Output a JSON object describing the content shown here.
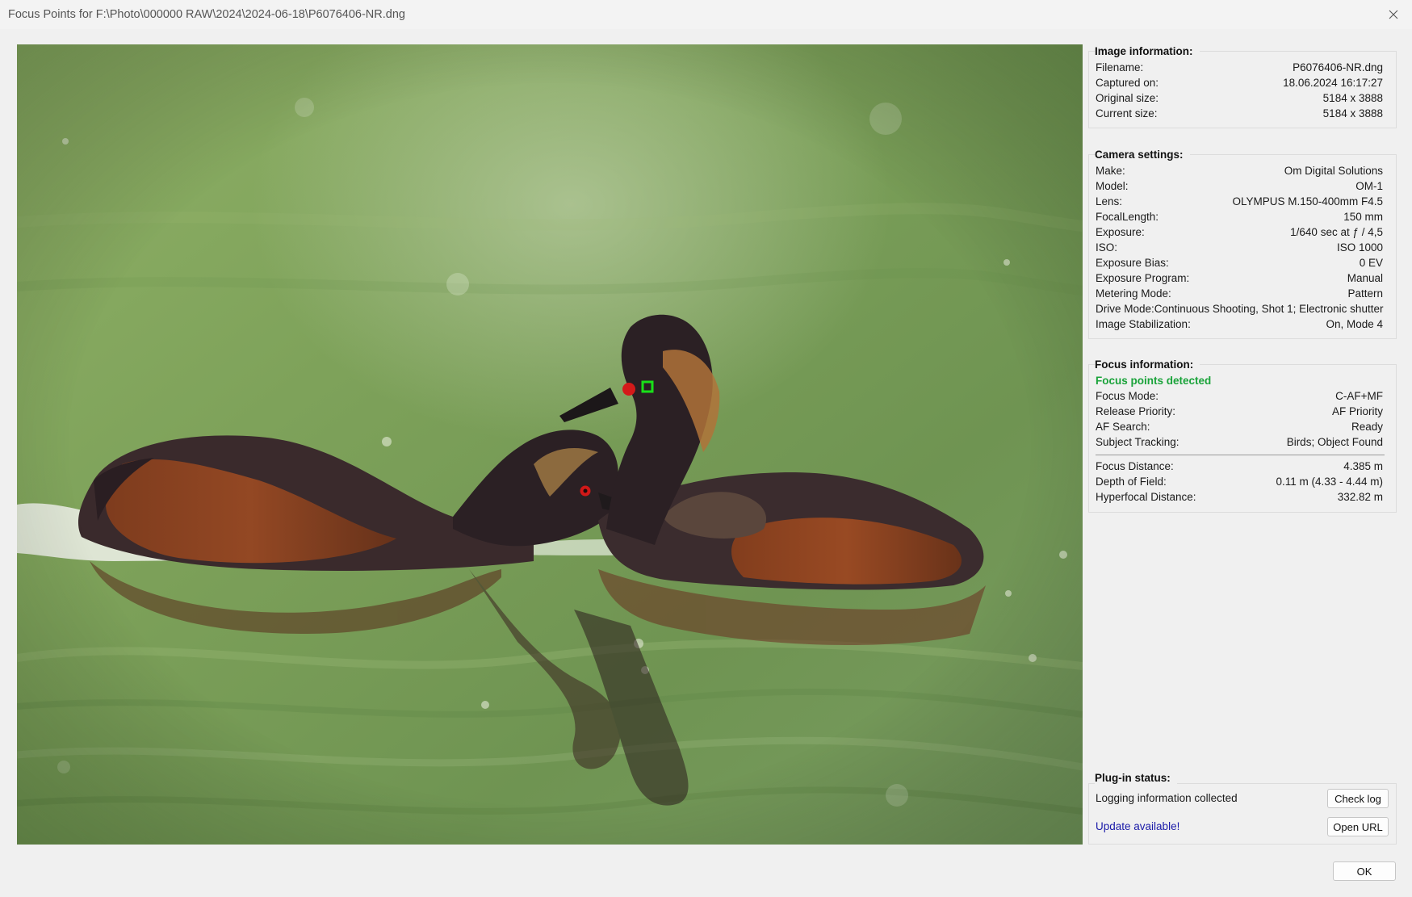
{
  "window": {
    "title": "Focus Points for F:\\Photo\\000000 RAW\\2024\\2024-06-18\\P6076406-NR.dng"
  },
  "image_info": {
    "title": "Image information:",
    "rows": [
      {
        "label": "Filename:",
        "value": "P6076406-NR.dng"
      },
      {
        "label": "Captured on:",
        "value": "18.06.2024 16:17:27"
      },
      {
        "label": "Original size:",
        "value": "5184 x 3888"
      },
      {
        "label": "Current size:",
        "value": "5184 x 3888"
      }
    ]
  },
  "camera_settings": {
    "title": "Camera settings:",
    "rows": [
      {
        "label": "Make:",
        "value": "Om Digital Solutions"
      },
      {
        "label": "Model:",
        "value": "OM-1"
      },
      {
        "label": "Lens:",
        "value": "OLYMPUS M.150-400mm F4.5"
      },
      {
        "label": "FocalLength:",
        "value": "150 mm"
      },
      {
        "label": "Exposure:",
        "value": "1/640 sec at ƒ / 4,5"
      },
      {
        "label": "ISO:",
        "value": "ISO 1000"
      },
      {
        "label": "Exposure Bias:",
        "value": "0 EV"
      },
      {
        "label": "Exposure Program:",
        "value": "Manual"
      },
      {
        "label": "Metering Mode:",
        "value": "Pattern"
      },
      {
        "label": "Drive Mode:",
        "value": "Continuous Shooting, Shot 1; Electronic shutter"
      },
      {
        "label": "Image Stabilization:",
        "value": "On, Mode 4"
      }
    ]
  },
  "focus_info": {
    "title": "Focus information:",
    "status": "Focus points detected",
    "rows": [
      {
        "label": "Focus Mode:",
        "value": "C-AF+MF"
      },
      {
        "label": "Release Priority:",
        "value": "AF Priority"
      },
      {
        "label": "AF Search:",
        "value": "Ready"
      },
      {
        "label": "Subject Tracking:",
        "value": "Birds; Object Found"
      }
    ],
    "distance_rows": [
      {
        "label": "Focus Distance:",
        "value": "4.385 m"
      },
      {
        "label": "Depth of Field:",
        "value": "0.11 m (4.33 - 4.44 m)"
      },
      {
        "label": "Hyperfocal Distance:",
        "value": "332.82 m"
      }
    ]
  },
  "plugin_status": {
    "title": "Plug-in status:",
    "logging_text": "Logging information collected",
    "check_log_label": "Check log",
    "update_text": "Update available!",
    "open_url_label": "Open URL"
  },
  "footer": {
    "ok_label": "OK"
  },
  "icons": {
    "close": "close-icon",
    "focus_point_active": "focus-point-active-icon",
    "face_detected": "face-detected-icon",
    "eye_detected": "eye-detected-icon"
  },
  "colors": {
    "focus_active": "#19e019",
    "face_detect": "#e01a1a",
    "status_green": "#1aa33a",
    "link": "#1a1aa8"
  }
}
